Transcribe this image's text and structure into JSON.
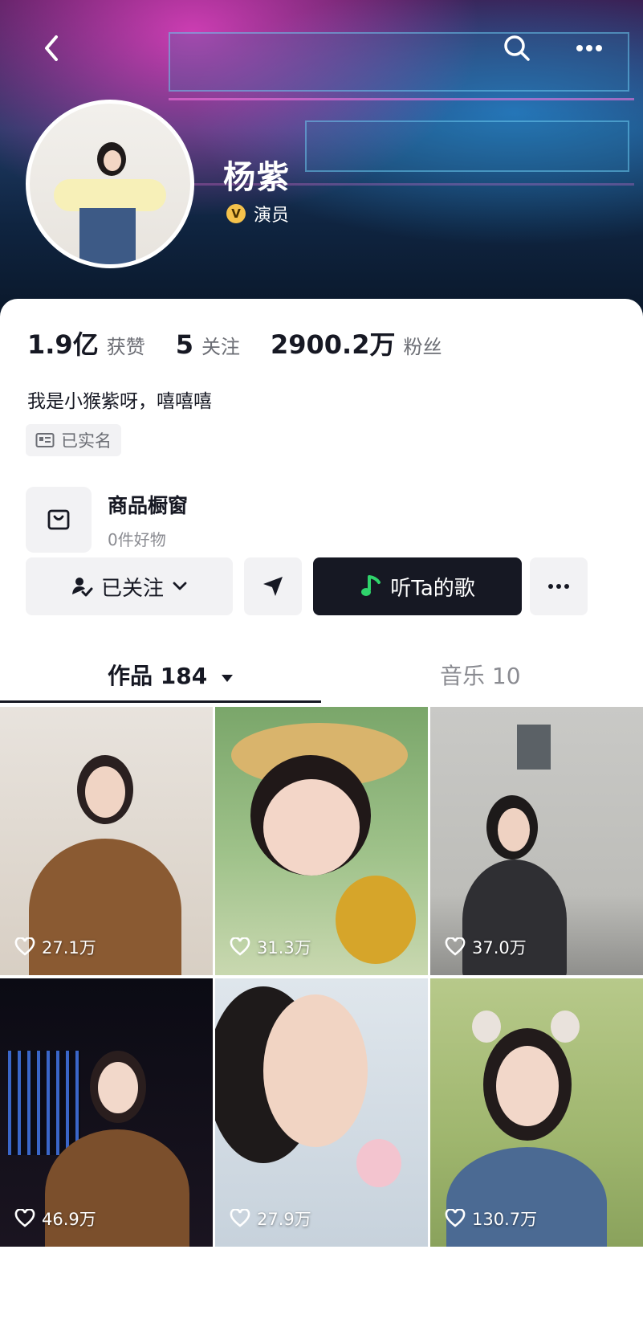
{
  "profile": {
    "name": "杨紫",
    "verification": "演员",
    "verification_badge": "V"
  },
  "stats": {
    "likes_value": "1.9亿",
    "likes_label": "获赞",
    "following_value": "5",
    "following_label": "关注",
    "followers_value": "2900.2万",
    "followers_label": "粉丝"
  },
  "bio": "我是小猴紫呀，嘻嘻嘻",
  "real_name_badge": "已实名",
  "shop": {
    "title": "商品橱窗",
    "subtitle": "0件好物"
  },
  "actions": {
    "follow_label": "已关注",
    "music_label": "听Ta的歌"
  },
  "tabs": {
    "works_label": "作品 184",
    "music_label": "音乐 10"
  },
  "videos": [
    {
      "likes": "27.1万"
    },
    {
      "likes": "31.3万"
    },
    {
      "likes": "37.0万"
    },
    {
      "likes": "46.9万"
    },
    {
      "likes": "27.9万"
    },
    {
      "likes": "130.7万"
    }
  ],
  "colors": {
    "primary_text": "#161823",
    "secondary_text": "#6b6d74",
    "dark_button": "#161823",
    "light_button": "#f2f2f4",
    "verify_badge": "#f5c24b",
    "music_icon_green": "#2fd36b"
  },
  "icons": [
    "back-icon",
    "search-icon",
    "more-icon",
    "id-card-icon",
    "bag-icon",
    "user-check-icon",
    "chevron-down-icon",
    "send-icon",
    "music-note-icon",
    "caret-down-icon",
    "heart-icon"
  ]
}
